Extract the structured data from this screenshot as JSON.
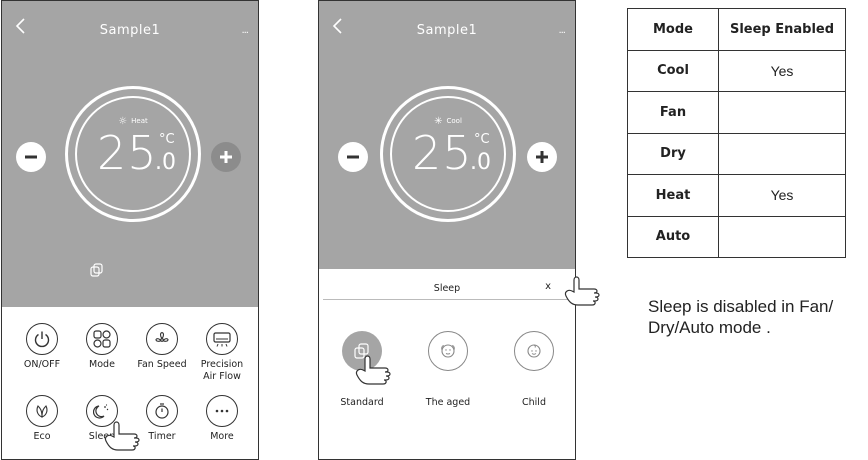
{
  "screen1": {
    "title": "Sample1",
    "more": "···",
    "mode_label": "Heat",
    "mode_symbol": "☼",
    "temp": "25",
    "unit": "°C",
    "decimal": ".0",
    "functions": [
      {
        "label": "ON/OFF",
        "icon": "power-icon"
      },
      {
        "label": "Mode",
        "icon": "mode-grid-icon"
      },
      {
        "label": "Fan Speed",
        "icon": "fan-icon"
      },
      {
        "label": "Precision Air Flow",
        "icon": "airflow-icon"
      },
      {
        "label": "Eco",
        "icon": "leaf-icon"
      },
      {
        "label": "Sleep",
        "icon": "moon-icon"
      },
      {
        "label": "Timer",
        "icon": "timer-icon"
      },
      {
        "label": "More",
        "icon": "more-icon"
      }
    ]
  },
  "screen2": {
    "title": "Sample1",
    "more": "···",
    "mode_label": "Cool",
    "mode_symbol": "✳",
    "temp": "25",
    "unit": "°C",
    "decimal": ".0",
    "sleep_title": "Sleep",
    "close": "x",
    "options": [
      {
        "label": "Standard",
        "icon": "standard-icon",
        "selected": true
      },
      {
        "label": "The aged",
        "icon": "aged-face-icon",
        "selected": false
      },
      {
        "label": "Child",
        "icon": "child-face-icon",
        "selected": false
      }
    ]
  },
  "table": {
    "headers": [
      "Mode",
      "Sleep Enabled"
    ],
    "rows": [
      [
        "Cool",
        "Yes"
      ],
      [
        "Fan",
        ""
      ],
      [
        "Dry",
        ""
      ],
      [
        "Heat",
        "Yes"
      ],
      [
        "Auto",
        ""
      ]
    ]
  },
  "note": "Sleep is disabled in Fan/ Dry/Auto mode ."
}
